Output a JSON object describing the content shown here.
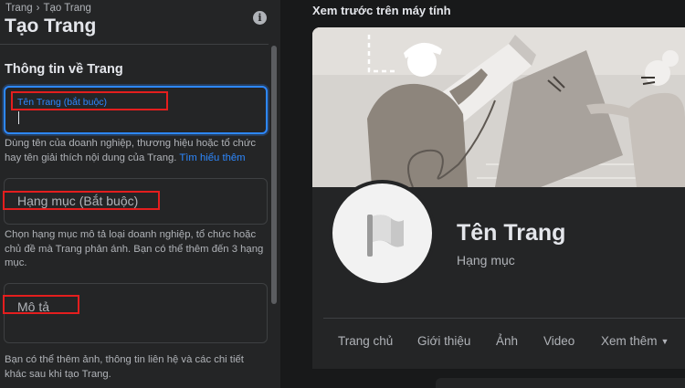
{
  "breadcrumb": {
    "items": [
      "Trang",
      "Tạo Trang"
    ],
    "separator": "›"
  },
  "header": {
    "title": "Tạo Trang",
    "info_icon": "i"
  },
  "form": {
    "section_title": "Thông tin về Trang",
    "name_field": {
      "label": "Tên Trang (bắt buộc)",
      "value": "",
      "help": "Dùng tên của doanh nghiệp, thương hiệu hoặc tổ chức hay tên giải thích nội dung của Trang.",
      "help_link": "Tìm hiểu thêm"
    },
    "category_field": {
      "label": "Hạng mục (Bắt buộc)",
      "help": "Chọn hạng mục mô tả loại doanh nghiệp, tổ chức hoặc chủ đề mà Trang phản ánh. Bạn có thể thêm đến 3 hạng mục."
    },
    "description_field": {
      "label": "Mô tả"
    },
    "extra_help": "Bạn có thể thêm ảnh, thông tin liên hệ và các chi tiết khác sau khi tạo Trang."
  },
  "preview": {
    "title": "Xem trước trên máy tính",
    "page_name": "Tên Trang",
    "category": "Hạng mục",
    "tabs": {
      "home": "Trang chủ",
      "about": "Giới thiệu",
      "photos": "Ảnh",
      "video": "Video",
      "more": "Xem thêm",
      "more_arrow": "▼"
    }
  },
  "colors": {
    "background": "#18191a",
    "panel": "#242526",
    "accent_blue": "#2d88ff",
    "highlight_red": "#e41e1e",
    "text_primary": "#e4e6eb",
    "text_secondary": "#b0b3b8"
  },
  "icons": [
    "info-icon",
    "flag-icon",
    "dropdown-arrow-icon"
  ]
}
